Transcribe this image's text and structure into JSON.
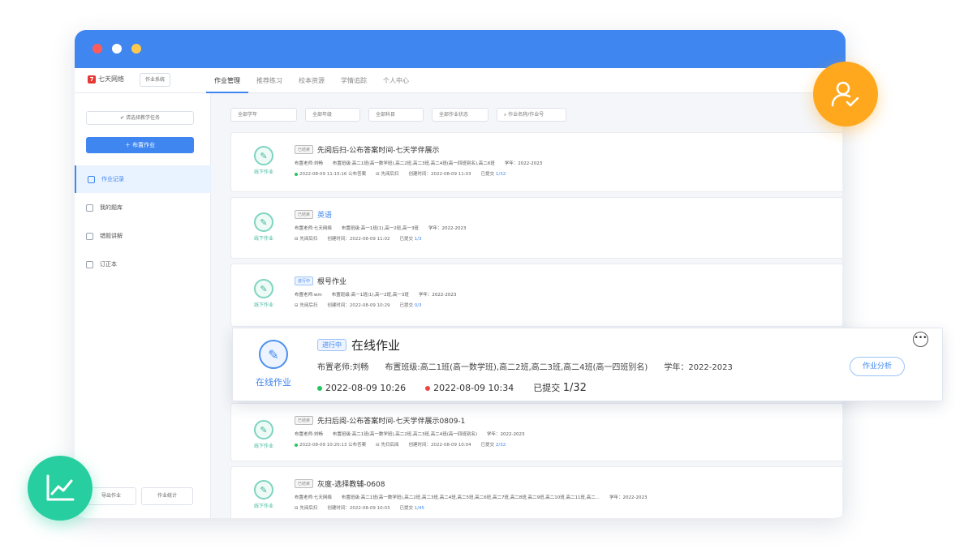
{
  "topnav": {
    "logo": "七天网络",
    "switch_label": "作业系统",
    "tabs": [
      {
        "label": "作业管理",
        "active": true
      },
      {
        "label": "推荐练习",
        "active": false
      },
      {
        "label": "校本资源",
        "active": false
      },
      {
        "label": "学情追踪",
        "active": false
      },
      {
        "label": "个人中心",
        "active": false
      }
    ]
  },
  "sidebar": {
    "class_select_placeholder": "请选择教学任务",
    "assign_button": "布置作业",
    "items": [
      {
        "label": "作业记录",
        "active": true
      },
      {
        "label": "我的题库",
        "active": false
      },
      {
        "label": "错题讲解",
        "active": false
      },
      {
        "label": "订正本",
        "active": false
      }
    ],
    "bottom_left": "导出作业",
    "bottom_right": "作业统计"
  },
  "filters": {
    "f1": "全部学年",
    "f2": "全部年级",
    "f3": "全部科目",
    "f4": "全部作业状态",
    "search_placeholder": "作业名称/作业号"
  },
  "cards": [
    {
      "icon_label": "线下作业",
      "badge": "已结束",
      "title": "先阅后扫-公布答案时间-七天学伴展示",
      "teacher": "布置老师:刘畅",
      "classes": "布置班级:高二1班(高一数学班),高二2班,高二3班,高二4班(高一四班别名),高二6班",
      "year": "学年：2022-2023",
      "publish": "2022-08-09 11:15:16 公布答案",
      "mode": "先阅后扫",
      "created": "创建时间：2022-08-09 11:03",
      "submitted_label": "已提交",
      "submitted": "1/32"
    },
    {
      "icon_label": "线下作业",
      "badge": "已结束",
      "title": "英语",
      "teacher": "布置老师:七天网络",
      "classes": "布置班级:高一1班(1),高一2班,高一3班",
      "year": "学年：2022-2023",
      "publish": "",
      "mode": "先阅后扫",
      "created": "创建时间：2022-08-09 11:02",
      "submitted_label": "已提交",
      "submitted": "1/3"
    },
    {
      "icon_label": "线下作业",
      "badge": "进行中",
      "title": "根号作业",
      "teacher": "布置老师:wm",
      "classes": "布置班级:高一1班(1),高一2班,高一3班",
      "year": "学年：2022-2023",
      "publish": "",
      "mode": "先阅后扫",
      "created": "创建时间：2022-08-09 10:29",
      "submitted_label": "已提交",
      "submitted": "0/3"
    },
    {
      "icon_label": "线下作业",
      "badge": "已结束",
      "title": "先扫后阅-公布答案时间-七天学伴展示0809-1",
      "teacher": "布置老师:刘畅",
      "classes": "布置班级:高二1班(高一数学班),高二2班,高二3班,高二4班(高一四班别名)",
      "year": "学年：2022-2023",
      "publish": "2022-08-09 10:20:13 公布答案",
      "mode": "先扫后阅",
      "created": "创建时间：2022-08-09 10:04",
      "submitted_label": "已提交",
      "submitted": "2/32"
    },
    {
      "icon_label": "线下作业",
      "badge": "已结束",
      "title": "灰度-选择教辅-0608",
      "teacher": "布置老师:七天网络",
      "classes": "布置班级:高二1班(高一数学班),高二2班,高二3班,高二4班,高二5班,高二6班,高二7班,高二8班,高二9班,高二10班,高二11班,高二...",
      "year": "学年：2022-2023",
      "publish": "",
      "mode": "先阅后扫",
      "created": "创建时间：2022-08-09 10:03",
      "submitted_label": "已提交",
      "submitted": "1/45"
    }
  ],
  "popout": {
    "icon_label": "在线作业",
    "badge": "进行中",
    "title": "在线作业",
    "teacher": "布置老师:刘畅",
    "classes": "布置班级:高二1班(高一数学班),高二2班,高二3班,高二4班(高一四班别名)",
    "year": "学年：2022-2023",
    "start": "2022-08-09 10:26",
    "end": "2022-08-09 10:34",
    "submitted_label": "已提交",
    "submitted": "1/32",
    "analysis_button": "作业分析",
    "more": "•••"
  },
  "colors": {
    "primary": "#3f86f0",
    "titlebar": "#3f86f0",
    "user_badge": "#ffa81e",
    "chart_badge": "#27cfa0",
    "offline_icon": "#3fb79a"
  }
}
